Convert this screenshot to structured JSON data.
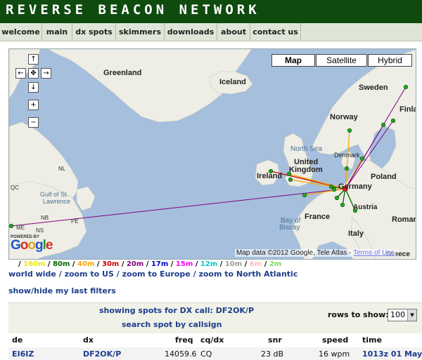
{
  "site": {
    "title": "REVERSE BEACON NETWORK"
  },
  "nav": [
    {
      "label": "welcome"
    },
    {
      "label": "main"
    },
    {
      "label": "dx spots"
    },
    {
      "label": "skimmers"
    },
    {
      "label": "downloads"
    },
    {
      "label": "about"
    },
    {
      "label": "contact us"
    }
  ],
  "map": {
    "type_buttons": [
      "Map",
      "Satellite",
      "Hybrid"
    ],
    "selected_type": "Map",
    "zoom_in": "+",
    "zoom_out": "−",
    "labels": {
      "greenland": "Greenland",
      "iceland": "Iceland",
      "sweden": "Sweden",
      "finland": "Finla",
      "norway": "Norway",
      "north_sea": "North Sea",
      "denmark": "Denmark",
      "united_kingdom_1": "United",
      "united_kingdom_2": "Kingdom",
      "ireland": "Ireland",
      "germany": "Germany",
      "poland": "Poland",
      "france": "France",
      "austria": "Austria",
      "bay_of_biscay_1": "Bay of",
      "bay_of_biscay_2": "Biscay",
      "italy": "Italy",
      "romania": "Roman",
      "greece": "Greece",
      "nl": "NL",
      "qc": "QC",
      "gulf_1": "Gulf of St.",
      "gulf_2": "Lawrence",
      "nb": "NB",
      "pe": "PE",
      "me": "ME",
      "ns": "NS"
    },
    "powered_by": "POWERED BY",
    "logo": "Google",
    "copyright": "Map data ©2012 Google, Tele Atlas -",
    "terms": "Terms of Use"
  },
  "bands": [
    {
      "label": "160m",
      "color": "#e8e800"
    },
    {
      "label": "80m",
      "color": "#006400"
    },
    {
      "label": "40m",
      "color": "#ffa500"
    },
    {
      "label": "30m",
      "color": "#cc0000"
    },
    {
      "label": "20m",
      "color": "#800080"
    },
    {
      "label": "17m",
      "color": "#0000cc"
    },
    {
      "label": "15m",
      "color": "#ff00ff"
    },
    {
      "label": "12m",
      "color": "#00cccc"
    },
    {
      "label": "10m",
      "color": "#999999"
    },
    {
      "label": "6m",
      "color": "#ffbbbb"
    },
    {
      "label": "2m",
      "color": "#77dd55"
    }
  ],
  "zoom_links": [
    "world wide",
    "zoom to US",
    "zoom to Europe",
    "zoom to North Atlantic"
  ],
  "filters_link": "show/hide my last filters",
  "search": {
    "showing": "showing spots for DX call: DF2OK/P",
    "search_link": "search spot by callsign",
    "rows_label": "rows to show:",
    "rows_value": "100"
  },
  "table": {
    "headers": [
      "de",
      "dx",
      "freq",
      "cq/dx",
      "snr",
      "speed",
      "time"
    ],
    "rows": [
      [
        "EI6IZ",
        "DF2OK/P",
        "14059.6",
        "CQ",
        "23 dB",
        "16 wpm",
        "1013z 01 May"
      ]
    ]
  }
}
